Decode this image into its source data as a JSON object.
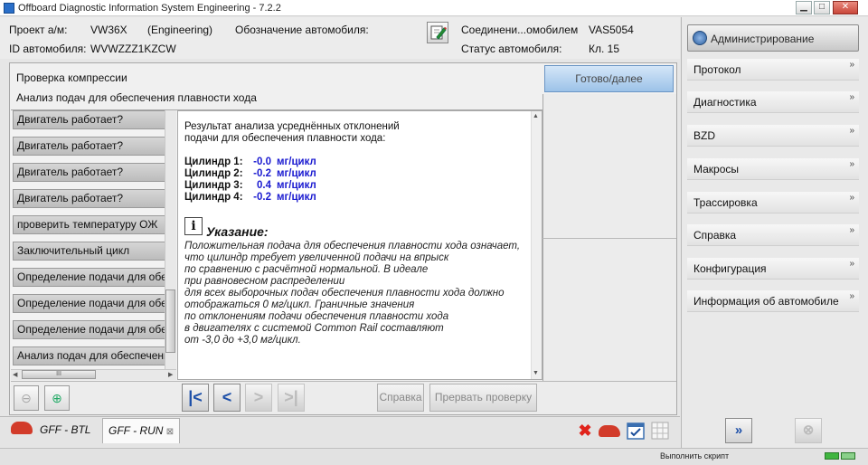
{
  "window": {
    "title": "Offboard Diagnostic Information System Engineering - 7.2.2",
    "buttons": {
      "minimize": "▁",
      "maximize": "□",
      "close": "✕"
    }
  },
  "header": {
    "project_label": "Проект а/м:",
    "project_value": "VW36X",
    "project_mode": "(Engineering)",
    "designation_label": "Обозначение автомобиля:",
    "vin_label": "ID автомобиля:",
    "vin_value": "WVWZZZ1KZCW",
    "connection_label": "Соединени...омобилем",
    "connection_value": "VAS5054",
    "status_label": "Статус автомобиля:",
    "status_value": "Кл. 15"
  },
  "sidebar": {
    "admin_button": "Администрирование",
    "items": [
      {
        "label": "Протокол"
      },
      {
        "label": "Диагностика"
      },
      {
        "label": "BZD"
      },
      {
        "label": "Макросы"
      },
      {
        "label": "Трассировка"
      },
      {
        "label": "Справка"
      },
      {
        "label": "Конфигурация"
      },
      {
        "label": "Информация об автомобиле"
      }
    ],
    "chevron": "»"
  },
  "main": {
    "title": "Проверка компрессии",
    "subtitle": "Анализ подач для обеспечения плавности хода",
    "ready_button": "Готово/далее",
    "steps": [
      "Двигатель работает?",
      "Двигатель работает?",
      "Двигатель работает?",
      "Двигатель работает?",
      "проверить температуру ОЖ",
      "Заключительный цикл",
      "Определение подачи для обесп",
      "Определение подачи для обесп",
      "Определение подачи для обесп",
      "Анализ подач для обеспечения"
    ],
    "hscroll_grip": "III",
    "result": {
      "intro_line1": "Результат анализа усреднённых отклонений",
      "intro_line2": "подачи для обеспечения плавности хода:",
      "cylinders": [
        {
          "label": "Цилиндр 1:",
          "value": "-0.0",
          "unit": "мг/цикл"
        },
        {
          "label": "Цилиндр 2:",
          "value": "-0.2",
          "unit": "мг/цикл"
        },
        {
          "label": "Цилиндр 3:",
          "value": "0.4",
          "unit": "мг/цикл"
        },
        {
          "label": "Цилиндр 4:",
          "value": "-0.2",
          "unit": "мг/цикл"
        }
      ],
      "note_title": "Указание:",
      "note_lines": [
        "Положительная подача для обеспечения плавности хода означает,",
        "что цилиндр требует увеличенной подачи на впрыск",
        "по сравнению с расчётной нормальной. В идеале",
        "при равновесном распределении",
        "для всех выборочных подач обеспечения плавности хода должно",
        "отображаться 0 мг/цикл. Граничные значения",
        "по отклонениям подачи обеспечения плавности хода",
        "в двигателях с системой Common Rail составляют",
        "от -3,0 до +3,0 мг/цикл."
      ]
    },
    "toolbar": {
      "help_button": "Справка",
      "abort_button": "Прервать проверку"
    }
  },
  "tabs": [
    {
      "label": "GFF - BTL"
    },
    {
      "label": "GFF - RUN",
      "close": "⊠"
    }
  ],
  "statusbar": {
    "text": "Выполнить скрипт"
  }
}
